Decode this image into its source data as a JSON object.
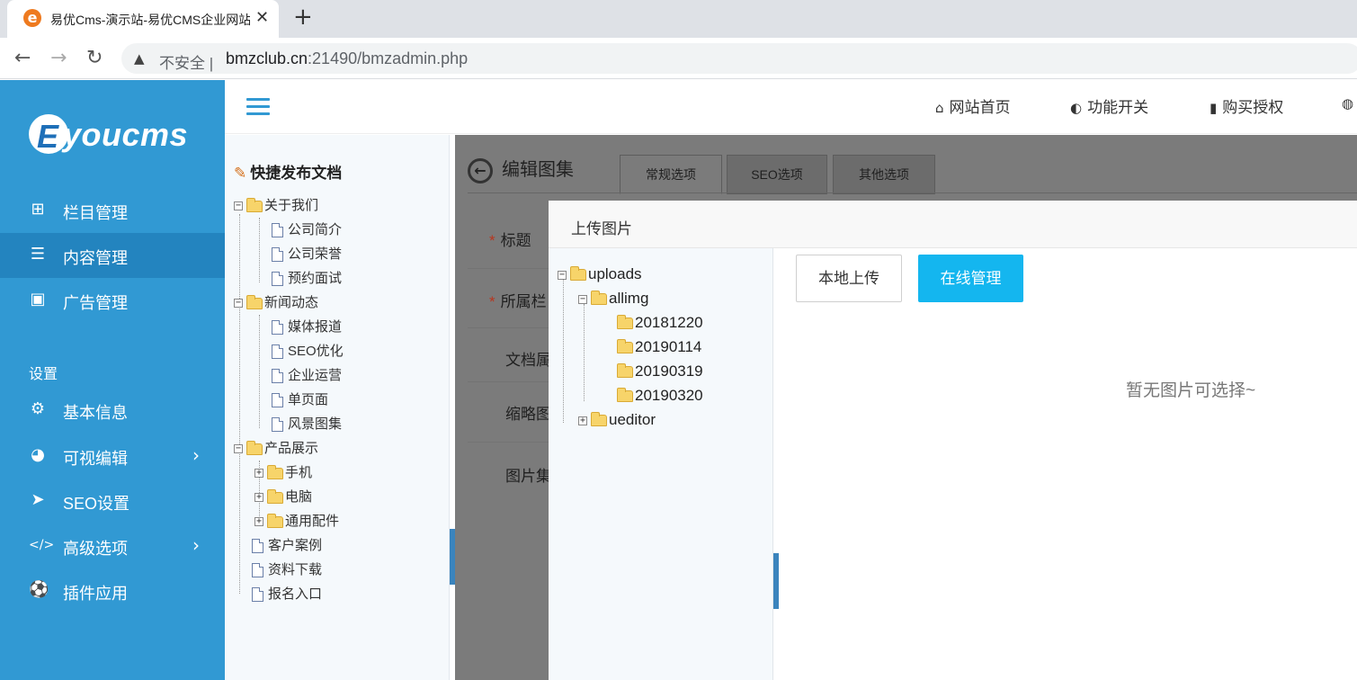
{
  "browser": {
    "tab_title": "易优Cms-演示站-易优CMS企业网站管理系统",
    "insecure_label": "不安全",
    "url_host": "bmzclub.cn",
    "url_rest": ":21490/bmzadmin.php",
    "icons": [
      "favicon-icon",
      "close-icon",
      "plus-icon",
      "back-icon",
      "forward-icon",
      "reload-icon",
      "warning-icon"
    ]
  },
  "sidebar": {
    "logo_letter": "E",
    "logo_text": "youcms",
    "items": [
      {
        "label": "栏目管理",
        "icon": "sitemap-icon",
        "glyph": "⊞"
      },
      {
        "label": "内容管理",
        "icon": "list-icon",
        "glyph": "☰",
        "active": true
      },
      {
        "label": "广告管理",
        "icon": "image-icon",
        "glyph": "▣"
      }
    ],
    "section_label": "设置",
    "settings": [
      {
        "label": "基本信息",
        "icon": "gear-icon",
        "glyph": "⚙"
      },
      {
        "label": "可视编辑",
        "icon": "palette-icon",
        "glyph": "◕",
        "arrow": "›"
      },
      {
        "label": "SEO设置",
        "icon": "paper-plane-icon",
        "glyph": "➤"
      },
      {
        "label": "高级选项",
        "icon": "code-icon",
        "glyph": "</>",
        "arrow": "›"
      },
      {
        "label": "插件应用",
        "icon": "puzzle-icon",
        "glyph": "⚽"
      }
    ],
    "colors": {
      "bg": "#3199d3",
      "active": "#2384bf"
    }
  },
  "topbar": {
    "links": [
      {
        "label": "网站首页",
        "icon": "home-icon",
        "glyph": "⌂"
      },
      {
        "label": "功能开关",
        "icon": "toggle-icon",
        "glyph": "◐"
      },
      {
        "label": "购买授权",
        "icon": "bookmark-icon",
        "glyph": "▮"
      },
      {
        "label": "",
        "icon": "globe-icon",
        "glyph": "◍"
      }
    ]
  },
  "quick": {
    "title": "快捷发布文档",
    "tree": {
      "about": "关于我们",
      "about_children": [
        "公司简介",
        "公司荣誉",
        "预约面试"
      ],
      "news": "新闻动态",
      "news_children": [
        "媒体报道",
        "SEO优化",
        "企业运营",
        "单页面",
        "风景图集"
      ],
      "products": "产品展示",
      "products_children": [
        "手机",
        "电脑",
        "通用配件"
      ],
      "cases": "客户案例",
      "downloads": "资料下载",
      "signup": "报名入口"
    }
  },
  "editor": {
    "title": "编辑图集",
    "tabs": [
      "常规选项",
      "SEO选项",
      "其他选项"
    ],
    "fields": [
      {
        "label": "标题",
        "required": true
      },
      {
        "label": "所属栏目",
        "required": true
      },
      {
        "label": "文档属性",
        "required": false
      },
      {
        "label": "缩略图",
        "required": false
      },
      {
        "label": "图片集",
        "required": false
      }
    ]
  },
  "dialog": {
    "title": "上传图片",
    "tree": {
      "root": "uploads",
      "allimg": "allimg",
      "dates": [
        "20181220",
        "20190114",
        "20190319",
        "20190320"
      ],
      "ueditor": "ueditor"
    },
    "btn_local": "本地上传",
    "btn_online": "在线管理",
    "empty_tip": "暂无图片可选择~",
    "accent": "#14b6ef"
  }
}
